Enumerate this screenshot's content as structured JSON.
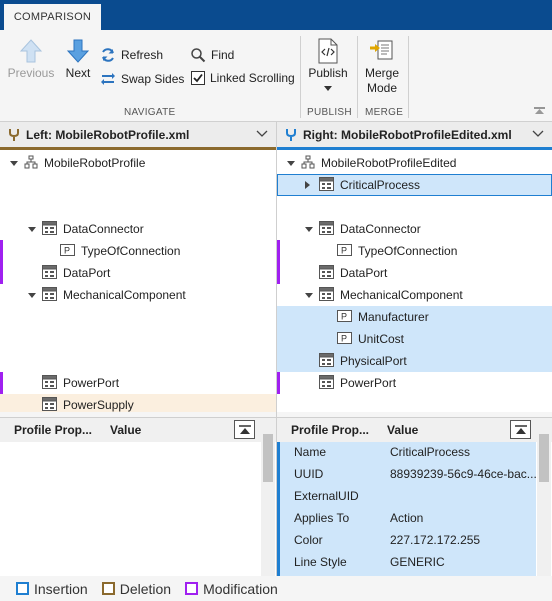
{
  "tab": {
    "label": "COMPARISON"
  },
  "toolbar": {
    "previous_label": "Previous",
    "next_label": "Next",
    "refresh_label": "Refresh",
    "swap_label": "Swap Sides",
    "find_label": "Find",
    "linked_label": "Linked Scrolling",
    "linked_checked": true,
    "publish_label": "Publish",
    "merge_label_line1": "Merge",
    "merge_label_line2": "Mode",
    "sections": {
      "navigate": "NAVIGATE",
      "publish": "PUBLISH",
      "merge": "MERGE"
    }
  },
  "left": {
    "title": "Left: MobileRobotProfile.xml",
    "tree": [
      {
        "label": "MobileRobotProfile",
        "icon": "profile-icon",
        "expanded": true,
        "level": 0,
        "marker": "",
        "highlight": ""
      },
      {
        "label": "",
        "level": 1,
        "placeholder": true
      },
      {
        "label": "",
        "level": 1,
        "placeholder": true
      },
      {
        "label": "DataConnector",
        "icon": "stereotype-icon",
        "expanded": true,
        "level": 1,
        "marker": "",
        "highlight": ""
      },
      {
        "label": "TypeOfConnection",
        "icon": "property-icon",
        "level": 2,
        "marker": "modification",
        "highlight": ""
      },
      {
        "label": "DataPort",
        "icon": "stereotype-icon",
        "level": 1,
        "marker": "modification",
        "highlight": ""
      },
      {
        "label": "MechanicalComponent",
        "icon": "stereotype-icon",
        "expanded": true,
        "level": 1,
        "marker": "",
        "highlight": ""
      },
      {
        "label": "",
        "level": 2,
        "placeholder": true
      },
      {
        "label": "",
        "level": 2,
        "placeholder": true
      },
      {
        "label": "",
        "level": 1,
        "placeholder": true
      },
      {
        "label": "PowerPort",
        "icon": "stereotype-icon",
        "level": 1,
        "marker": "modification",
        "highlight": ""
      },
      {
        "label": "PowerSupply",
        "icon": "stereotype-icon",
        "level": 1,
        "marker": "deletion",
        "highlight": "deletion"
      }
    ],
    "props": {
      "col1": "Profile Prop...",
      "col2": "Value",
      "rows": []
    }
  },
  "right": {
    "title": "Right: MobileRobotProfileEdited.xml",
    "tree": [
      {
        "label": "MobileRobotProfileEdited",
        "icon": "profile-icon",
        "expanded": true,
        "level": 0,
        "marker": "",
        "highlight": ""
      },
      {
        "label": "CriticalProcess",
        "icon": "stereotype-icon",
        "collapsed": true,
        "level": 1,
        "marker": "insertion",
        "highlight": "selected"
      },
      {
        "label": "",
        "level": 1,
        "placeholder": true
      },
      {
        "label": "DataConnector",
        "icon": "stereotype-icon",
        "expanded": true,
        "level": 1,
        "marker": "",
        "highlight": ""
      },
      {
        "label": "TypeOfConnection",
        "icon": "property-icon",
        "level": 2,
        "marker": "modification",
        "highlight": ""
      },
      {
        "label": "DataPort",
        "icon": "stereotype-icon",
        "level": 1,
        "marker": "modification",
        "highlight": ""
      },
      {
        "label": "MechanicalComponent",
        "icon": "stereotype-icon",
        "expanded": true,
        "level": 1,
        "marker": "",
        "highlight": ""
      },
      {
        "label": "Manufacturer",
        "icon": "property-icon",
        "level": 2,
        "marker": "insertion",
        "highlight": "insertion"
      },
      {
        "label": "UnitCost",
        "icon": "property-icon",
        "level": 2,
        "marker": "insertion",
        "highlight": "insertion"
      },
      {
        "label": "PhysicalPort",
        "icon": "stereotype-icon",
        "level": 1,
        "marker": "insertion",
        "highlight": "insertion"
      },
      {
        "label": "PowerPort",
        "icon": "stereotype-icon",
        "level": 1,
        "marker": "modification",
        "highlight": ""
      },
      {
        "label": "",
        "level": 1,
        "placeholder": true
      }
    ],
    "props": {
      "col1": "Profile Prop...",
      "col2": "Value",
      "rows": [
        {
          "name": "Name",
          "value": "CriticalProcess"
        },
        {
          "name": "UUID",
          "value": "88939239-56c9-46ce-bac..."
        },
        {
          "name": "ExternalUID",
          "value": ""
        },
        {
          "name": "Applies To",
          "value": "Action"
        },
        {
          "name": "Color",
          "value": "227.172.172.255"
        },
        {
          "name": "Line Style",
          "value": "GENERIC"
        }
      ]
    }
  },
  "legend": {
    "insertion": "Insertion",
    "deletion": "Deletion",
    "modification": "Modification"
  },
  "colors": {
    "insertion": "#1f7fd1",
    "deletion": "#8b6a2e",
    "modification": "#a020f0",
    "insertion_bg": "#cfe6fa",
    "deletion_bg": "#fbefdf",
    "selected_bg": "#cfe6fa"
  }
}
